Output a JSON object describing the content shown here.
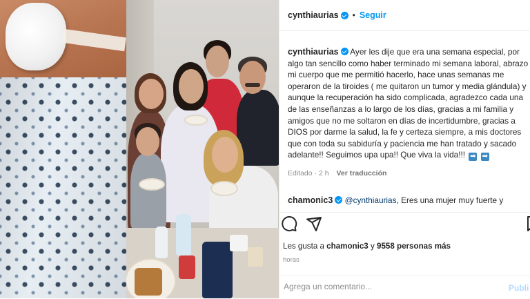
{
  "post": {
    "header": {
      "username": "cynthiaurias",
      "separator": "•",
      "follow_label": "Seguir"
    },
    "caption": {
      "username": "cynthiaurias",
      "text": "Ayer les dije que era una semana especial, por algo tan sencillo como haber terminado mi semana laboral, abrazo mi cuerpo que me permitió hacerlo, hace unas semanas me operaron de la tiroides ( me quitaron un tumor y media glándula) y aunque la recuperación ha sido complicada, agradezco cada una de las enseñanzas a lo largo de los días, gracias a mi familia y amigos que no me soltaron en días de incertidumbre, gracias a DIOS por darme la salud, la fe y certeza siempre, a mis doctores que con toda su sabiduría y paciencia me han tratado y sacado adelante!! Seguimos upa upa!! Que viva la vida!!!",
      "emoji_1": "➡",
      "emoji_2": "➡"
    },
    "meta": {
      "edited_time": "Editado · 2 h",
      "translate_label": "Ver traducción"
    },
    "comment": {
      "username": "chamonic3",
      "mention": "@cynthiaurias",
      "text": ", Eres una mujer muy fuerte y"
    },
    "likes": {
      "prefix": "Les gusta a ",
      "user": "chamonic3",
      "middle": " y ",
      "count_text": "9558 personas más"
    },
    "time_label": "horas",
    "add_comment_placeholder": "Agrega un comentario...",
    "publish_label": "Publi"
  },
  "icons": {
    "comment": "comment-icon",
    "share": "send-icon",
    "save": "bookmark-icon",
    "verified": "verified-badge-icon"
  },
  "colors": {
    "accent": "#0095f6",
    "verified": "#0095f6",
    "mention": "#00376b",
    "muted": "#8e8e8e"
  }
}
